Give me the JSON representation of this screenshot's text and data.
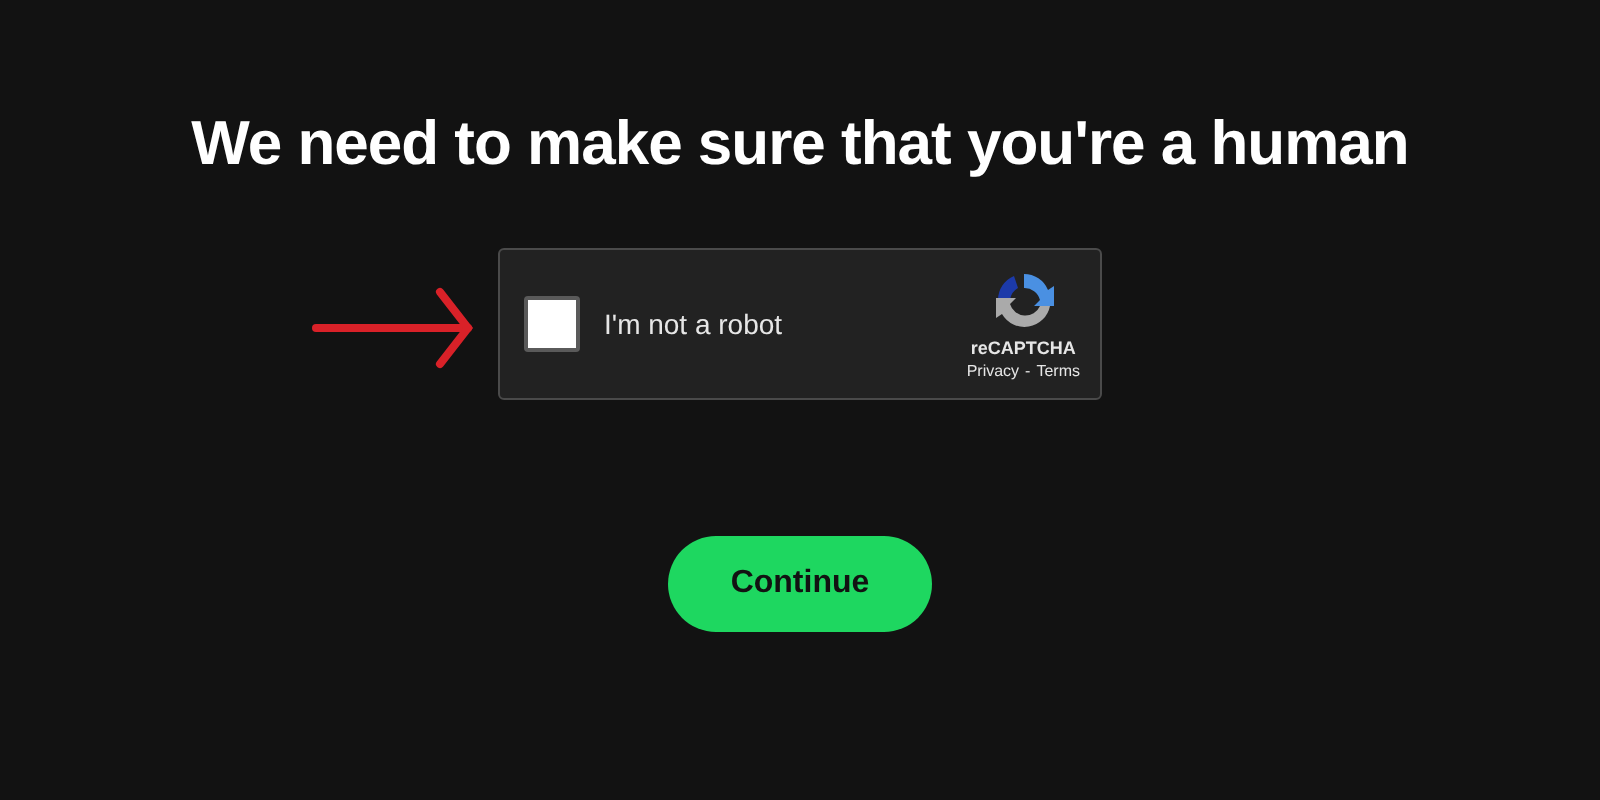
{
  "heading": "We need to make sure that you're a human",
  "captcha": {
    "checked": false,
    "label": "I'm not a robot",
    "brand": "reCAPTCHA",
    "links": [
      "Privacy",
      "Terms"
    ],
    "separator": "-"
  },
  "button": {
    "label": "Continue"
  }
}
